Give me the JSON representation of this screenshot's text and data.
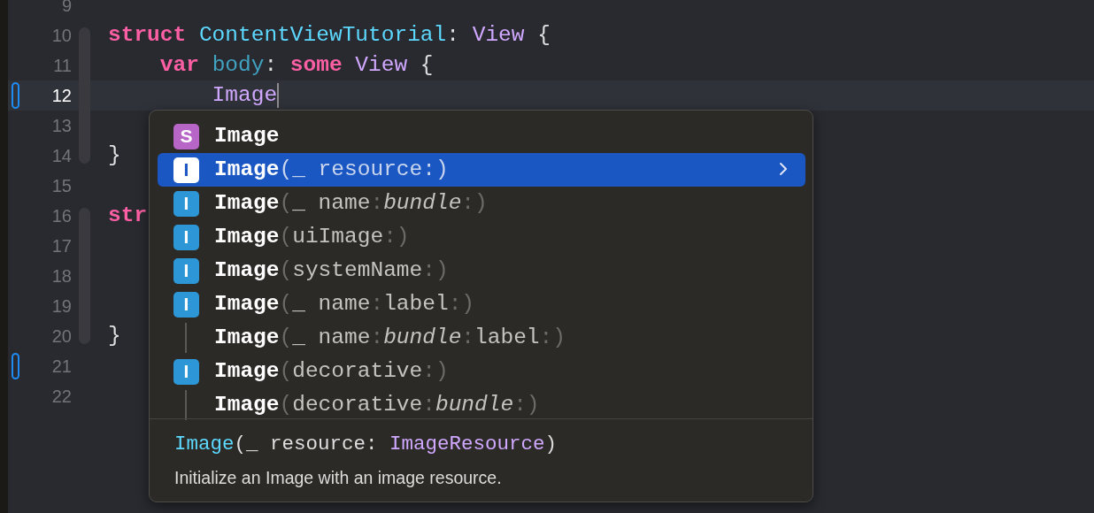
{
  "editor": {
    "lines": [
      {
        "number": "9",
        "current": false,
        "marker": false
      },
      {
        "number": "10",
        "current": false,
        "marker": false,
        "tokens": [
          {
            "kind": "keyword",
            "text": "struct "
          },
          {
            "kind": "declaration",
            "text": "ContentViewTutorial"
          },
          {
            "kind": "plain",
            "text": ": "
          },
          {
            "kind": "type",
            "text": "View"
          },
          {
            "kind": "plain",
            "text": " {"
          }
        ]
      },
      {
        "number": "11",
        "current": false,
        "marker": false,
        "tokens": [
          {
            "kind": "keyword",
            "text": "    var "
          },
          {
            "kind": "property",
            "text": "body"
          },
          {
            "kind": "plain",
            "text": ": "
          },
          {
            "kind": "keyword",
            "text": "some "
          },
          {
            "kind": "type",
            "text": "View"
          },
          {
            "kind": "plain",
            "text": " {"
          }
        ]
      },
      {
        "number": "12",
        "current": true,
        "marker": true,
        "cursor": true,
        "tokens": [
          {
            "kind": "type",
            "text": "        Image"
          }
        ]
      },
      {
        "number": "13",
        "current": false,
        "marker": false
      },
      {
        "number": "14",
        "current": false,
        "marker": false,
        "tokens": [
          {
            "kind": "plain",
            "text": "}"
          }
        ]
      },
      {
        "number": "15",
        "current": false,
        "marker": false
      },
      {
        "number": "16",
        "current": false,
        "marker": false,
        "tokens": [
          {
            "kind": "keyword",
            "text": "str"
          }
        ]
      },
      {
        "number": "17",
        "current": false,
        "marker": false
      },
      {
        "number": "18",
        "current": false,
        "marker": false
      },
      {
        "number": "19",
        "current": false,
        "marker": false
      },
      {
        "number": "20",
        "current": false,
        "marker": false,
        "tokens": [
          {
            "kind": "plain",
            "text": "}"
          }
        ]
      },
      {
        "number": "21",
        "current": false,
        "marker": true
      },
      {
        "number": "22",
        "current": false,
        "marker": false
      }
    ]
  },
  "completion": {
    "items": [
      {
        "kind": "struct",
        "icon": "S",
        "selected": false,
        "parts": [
          {
            "kind": "name",
            "text": "Image"
          }
        ]
      },
      {
        "kind": "initializer",
        "icon": "I",
        "selected": true,
        "parts": [
          {
            "kind": "name",
            "text": "Image"
          },
          {
            "kind": "punct",
            "text": "("
          },
          {
            "kind": "label",
            "text": "_ resource"
          },
          {
            "kind": "punct",
            "text": ":)"
          }
        ]
      },
      {
        "kind": "initializer",
        "icon": "I",
        "selected": false,
        "parts": [
          {
            "kind": "name",
            "text": "Image"
          },
          {
            "kind": "punct",
            "text": "("
          },
          {
            "kind": "label",
            "text": "_ name"
          },
          {
            "kind": "punct",
            "text": ":"
          },
          {
            "kind": "italic",
            "text": "bundle"
          },
          {
            "kind": "punct",
            "text": ":)"
          }
        ]
      },
      {
        "kind": "initializer",
        "icon": "I",
        "selected": false,
        "parts": [
          {
            "kind": "name",
            "text": "Image"
          },
          {
            "kind": "punct",
            "text": "("
          },
          {
            "kind": "label",
            "text": "uiImage"
          },
          {
            "kind": "punct",
            "text": ":)"
          }
        ]
      },
      {
        "kind": "initializer",
        "icon": "I",
        "selected": false,
        "parts": [
          {
            "kind": "name",
            "text": "Image"
          },
          {
            "kind": "punct",
            "text": "("
          },
          {
            "kind": "label",
            "text": "systemName"
          },
          {
            "kind": "punct",
            "text": ":)"
          }
        ]
      },
      {
        "kind": "initializer",
        "icon": "I",
        "selected": false,
        "parts": [
          {
            "kind": "name",
            "text": "Image"
          },
          {
            "kind": "punct",
            "text": "("
          },
          {
            "kind": "label",
            "text": "_ name"
          },
          {
            "kind": "punct",
            "text": ":"
          },
          {
            "kind": "label",
            "text": "label"
          },
          {
            "kind": "punct",
            "text": ":)"
          }
        ]
      },
      {
        "kind": "overload",
        "selected": false,
        "parts": [
          {
            "kind": "name",
            "text": "Image"
          },
          {
            "kind": "punct",
            "text": "("
          },
          {
            "kind": "label",
            "text": "_ name"
          },
          {
            "kind": "punct",
            "text": ":"
          },
          {
            "kind": "italic",
            "text": "bundle"
          },
          {
            "kind": "punct",
            "text": ":"
          },
          {
            "kind": "label",
            "text": "label"
          },
          {
            "kind": "punct",
            "text": ":)"
          }
        ]
      },
      {
        "kind": "initializer",
        "icon": "I",
        "selected": false,
        "parts": [
          {
            "kind": "name",
            "text": "Image"
          },
          {
            "kind": "punct",
            "text": "("
          },
          {
            "kind": "label",
            "text": "decorative"
          },
          {
            "kind": "punct",
            "text": ":)"
          }
        ]
      },
      {
        "kind": "overload",
        "selected": false,
        "parts": [
          {
            "kind": "name",
            "text": "Image"
          },
          {
            "kind": "punct",
            "text": "("
          },
          {
            "kind": "label",
            "text": "decorative"
          },
          {
            "kind": "punct",
            "text": ":"
          },
          {
            "kind": "italic",
            "text": "bundle"
          },
          {
            "kind": "punct",
            "text": ":)"
          }
        ]
      }
    ],
    "detail": {
      "signature": [
        {
          "kind": "declaration",
          "text": "Image"
        },
        {
          "kind": "plain",
          "text": "(_ resource: "
        },
        {
          "kind": "type",
          "text": "ImageResource"
        },
        {
          "kind": "plain",
          "text": ")"
        }
      ],
      "description": "Initialize an Image with an image resource."
    }
  }
}
